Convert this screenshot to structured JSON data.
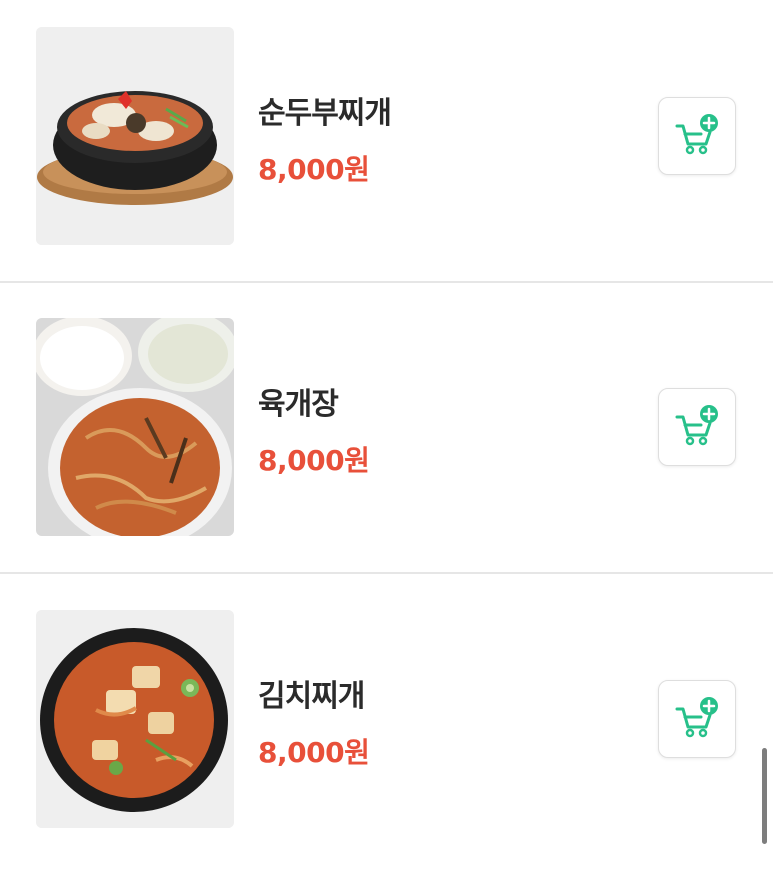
{
  "menu": {
    "items": [
      {
        "name": "순두부찌개",
        "price": "8,000원",
        "image": "sundubu-jjigae-photo"
      },
      {
        "name": "육개장",
        "price": "8,000원",
        "image": "yukgaejang-photo"
      },
      {
        "name": "김치찌개",
        "price": "8,000원",
        "image": "kimchi-jjigae-photo"
      }
    ],
    "cart_icon": "add-to-cart-icon"
  },
  "colors": {
    "price": "#e8503a",
    "accent_green": "#27c08a",
    "divider": "#e6e6e6",
    "name_text": "#2b2b2b"
  }
}
